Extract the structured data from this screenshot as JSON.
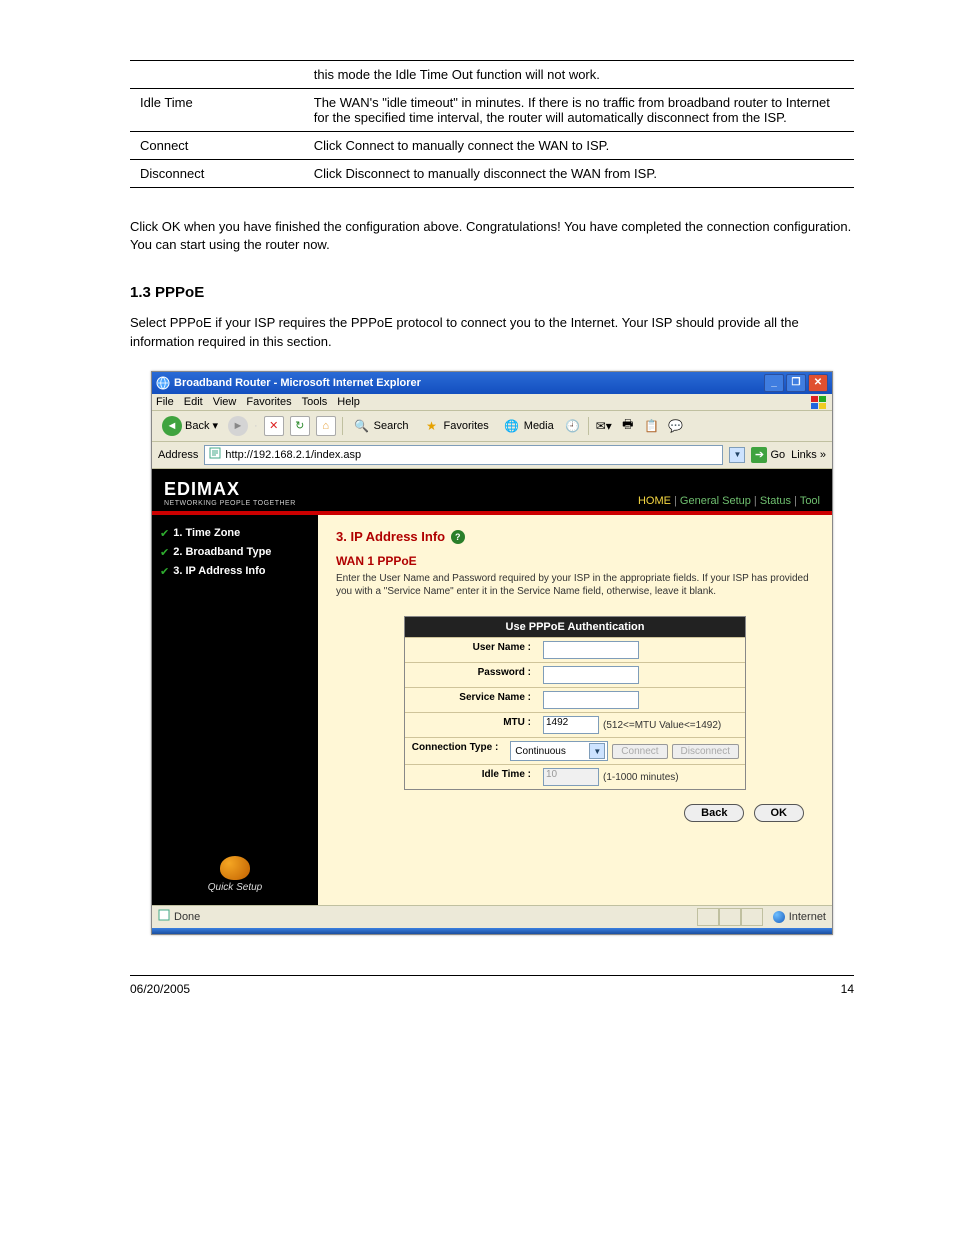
{
  "doc_table": {
    "rows": [
      [
        "",
        "this mode the Idle Time Out function will not work."
      ],
      [
        "Idle Time",
        "The WAN's \"idle timeout\" in minutes. If there is no traffic from broadband router to Internet for the specified time interval, the router will automatically disconnect from the ISP."
      ],
      [
        "Connect",
        "Click Connect to manually connect the WAN to ISP."
      ],
      [
        "Disconnect",
        "Click Disconnect to manually disconnect the WAN from ISP."
      ]
    ]
  },
  "after_table": "Click OK when you have finished the configuration above. Congratulations! You have completed the connection configuration. You can start using the router now.",
  "section_title": "1.3 PPPoE",
  "section_para": "Select PPPoE if your ISP requires the PPPoE protocol to connect you to the Internet. Your ISP should provide all the information required in this section.",
  "browser": {
    "title": "Broadband Router - Microsoft Internet Explorer",
    "menus": [
      "File",
      "Edit",
      "View",
      "Favorites",
      "Tools",
      "Help"
    ],
    "back": "Back",
    "search": "Search",
    "favorites": "Favorites",
    "media": "Media",
    "address_label": "Address",
    "url": "http://192.168.2.1/index.asp",
    "go": "Go",
    "links": "Links",
    "status_left": "Done",
    "status_right": "Internet"
  },
  "routerpage": {
    "logo": "EDIMAX",
    "logo_sub": "NETWORKING PEOPLE TOGETHER",
    "topnav": {
      "home": "HOME",
      "general": "General Setup",
      "status": "Status",
      "tool": "Tool"
    },
    "sidenav": [
      "1. Time Zone",
      "2. Broadband Type",
      "3. IP Address Info"
    ],
    "quick": "Quick Setup",
    "heading": "3. IP Address Info",
    "subheading": "WAN 1 PPPoE",
    "desc": "Enter the User Name and Password required by your ISP in the appropriate fields. If your ISP has provided you with a \"Service Name\" enter it in the Service Name field, otherwise, leave it blank.",
    "form": {
      "title": "Use PPPoE Authentication",
      "user_label": "User Name :",
      "user_value": "",
      "pass_label": "Password :",
      "pass_value": "",
      "svc_label": "Service Name :",
      "svc_value": "",
      "mtu_label": "MTU :",
      "mtu_value": "1492",
      "mtu_hint": "(512<=MTU Value<=1492)",
      "conn_label": "Connection Type :",
      "conn_value": "Continuous",
      "connect_btn": "Connect",
      "disconnect_btn": "Disconnect",
      "idle_label": "Idle Time :",
      "idle_value": "10",
      "idle_hint": "(1-1000 minutes)"
    },
    "back_btn": "Back",
    "ok_btn": "OK"
  },
  "footer": {
    "left": "06/20/2005",
    "right": "14"
  }
}
